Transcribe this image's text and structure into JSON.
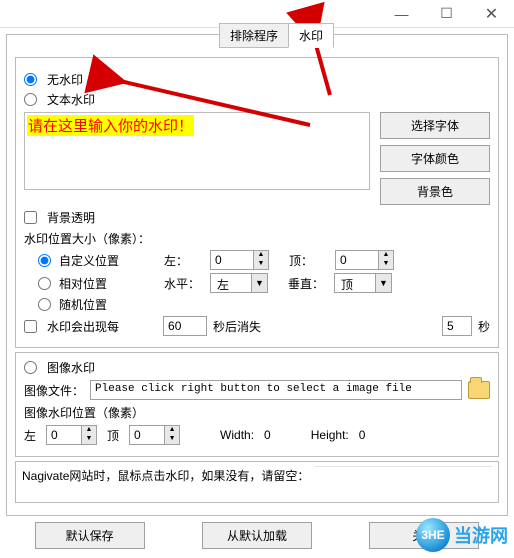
{
  "titlebar": {
    "min": "—",
    "max": "☐",
    "close": "✕"
  },
  "tabs": {
    "exclude": "排除程序",
    "watermark": "水印"
  },
  "wm": {
    "none": "无水印",
    "text": "文本水印",
    "placeholder_text": "请在这里输入你的水印！",
    "btn_font": "选择字体",
    "btn_color": "字体颜色",
    "btn_bg": "背景色",
    "bg_transparent": "背景透明",
    "pos_label": "水印位置大小（像素）：",
    "pos_custom": "自定义位置",
    "pos_relative": "相对位置",
    "pos_random": "随机位置",
    "left": "左：",
    "top": "顶：",
    "horiz": "水平：",
    "vert": "垂直：",
    "horiz_val": "左",
    "vert_val": "顶",
    "left_val": "0",
    "top_val": "0",
    "reappear_chk": "水印会出现每",
    "reappear_val": "60",
    "reappear_after": "秒后消失",
    "reappear_sec_val": "5",
    "reappear_sec_unit": "秒",
    "image_radio": "图像水印",
    "image_file_lbl": "图像文件：",
    "image_file_text": "Please click right button to select a image file",
    "image_pos_lbl": "图像水印位置（像素）",
    "img_left": "左",
    "img_left_val": "0",
    "img_top": "顶",
    "img_top_val": "0",
    "width_lbl": "Width:",
    "width_val": "0",
    "height_lbl": "Height:",
    "height_val": "0"
  },
  "nav": {
    "label": "Nagivate网站时，鼠标点击水印，如果没有，请留空："
  },
  "bottom": {
    "save": "默认保存",
    "load": "从默认加载",
    "close": "关闭"
  },
  "logo": {
    "orb": "3HE",
    "text": "当游网"
  }
}
